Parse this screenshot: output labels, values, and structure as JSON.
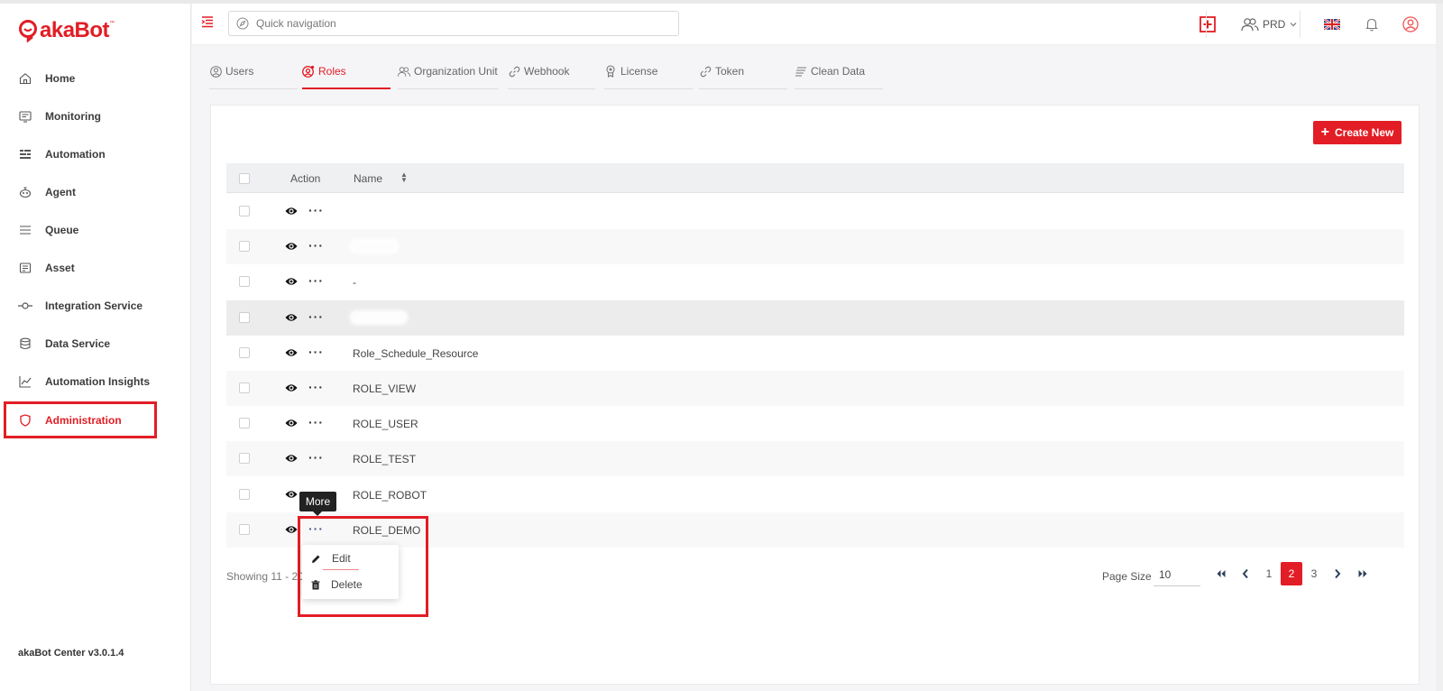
{
  "app": {
    "logo_prefix": "aka",
    "logo_suffix": "Bot",
    "logo_tm": "™",
    "version": "akaBot Center v3.0.1.4"
  },
  "sidebar": {
    "items": [
      {
        "label": "Home",
        "icon": "home-icon"
      },
      {
        "label": "Monitoring",
        "icon": "monitor-icon"
      },
      {
        "label": "Automation",
        "icon": "automation-icon"
      },
      {
        "label": "Agent",
        "icon": "agent-icon"
      },
      {
        "label": "Queue",
        "icon": "queue-icon"
      },
      {
        "label": "Asset",
        "icon": "asset-icon"
      },
      {
        "label": "Integration Service",
        "icon": "integration-icon"
      },
      {
        "label": "Data Service",
        "icon": "database-icon"
      },
      {
        "label": "Automation Insights",
        "icon": "chart-icon"
      },
      {
        "label": "Administration",
        "icon": "shield-icon",
        "active": true
      }
    ]
  },
  "header": {
    "search_placeholder": "Quick navigation",
    "environment": "PRD"
  },
  "tabs": [
    {
      "label": "Users"
    },
    {
      "label": "Roles",
      "active": true
    },
    {
      "label": "Organization Unit"
    },
    {
      "label": "Webhook"
    },
    {
      "label": "License"
    },
    {
      "label": "Token"
    },
    {
      "label": "Clean Data"
    }
  ],
  "toolbar": {
    "create_label": "Create New"
  },
  "table": {
    "columns": {
      "action": "Action",
      "name": "Name"
    },
    "rows": [
      {
        "name": ""
      },
      {
        "name": ""
      },
      {
        "name": "-"
      },
      {
        "name": ""
      },
      {
        "name": "Role_Schedule_Resource"
      },
      {
        "name": "ROLE_VIEW"
      },
      {
        "name": "ROLE_USER"
      },
      {
        "name": "ROLE_TEST"
      },
      {
        "name": "ROLE_ROBOT"
      },
      {
        "name": "ROLE_DEMO"
      }
    ]
  },
  "footer": {
    "showing": "Showing 11 - 20",
    "page_size_label": "Page Size",
    "page_size": "10",
    "pages": [
      "1",
      "2",
      "3"
    ],
    "current_page": "2"
  },
  "tooltip": {
    "text": "More"
  },
  "dropdown": {
    "edit_label": "Edit",
    "delete_label": "Delete"
  },
  "colors": {
    "accent": "#e21d25"
  }
}
